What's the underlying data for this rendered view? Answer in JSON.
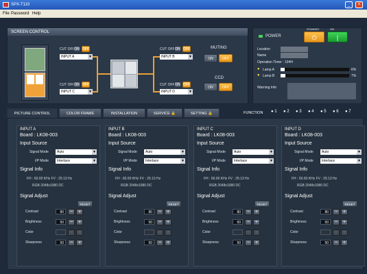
{
  "window": {
    "title": "SPX-T110"
  },
  "menu": [
    "File",
    "Password",
    "Help"
  ],
  "screen_control": {
    "title": "SCREEN CONTROL",
    "cut_off_label": "CUT OFF",
    "on": "ON",
    "off": "OFF",
    "inputs": [
      {
        "value": "INPUT A"
      },
      {
        "value": "INPUT B"
      },
      {
        "value": "INPUT C"
      },
      {
        "value": "INPUT D"
      }
    ],
    "muting_label": "MUTING",
    "ccd_label": "CCD"
  },
  "status": {
    "power_label": "POWER",
    "standby_label": "STANDBY",
    "on_label": "ON",
    "location_label": "Location",
    "name_label": "Name",
    "operation_timer": "Operation Timer : 194H",
    "lamp_a_label": "Lamp A",
    "lamp_a_value": "6%",
    "lamp_b_label": "Lamp B",
    "lamp_b_value": "7%",
    "warning_label": "Warning Info"
  },
  "tabs": [
    {
      "label": "PICTURE CONTROL"
    },
    {
      "label": "COLOR FRAME"
    },
    {
      "label": "INSTALLATION"
    },
    {
      "label": "SERVICE"
    },
    {
      "label": "SETTING"
    }
  ],
  "function": {
    "label": "FUNCTION",
    "items": [
      "1",
      "2",
      "3",
      "4",
      "5",
      "6",
      "7"
    ]
  },
  "input_columns": [
    {
      "name": "INPUT A",
      "board": "Board : LK08-003",
      "input_source": "Input Source",
      "signal_mode_label": "Signal Mode",
      "signal_mode": "Auto",
      "ip_mode_label": "I/P Mode",
      "ip_mode": "Interlace",
      "signal_info": "Signal Info",
      "fh_fv": "FH : 60.00 KHz    FV : 29.13 Hz",
      "rgb": "RGB  2048x1080 DC",
      "signal_adjust": "Signal Adjust",
      "reset": "RESET",
      "contrast_label": "Contrast",
      "contrast": "80",
      "brightness_label": "Brightness",
      "brightness": "50",
      "color_label": "Color",
      "sharpness_label": "Sharpness",
      "sharpness": "50"
    },
    {
      "name": "INPUT B",
      "board": "Board : LK08-003",
      "input_source": "Input Source",
      "signal_mode_label": "Signal Mode",
      "signal_mode": "Auto",
      "ip_mode_label": "I/P Mode",
      "ip_mode": "Interlace",
      "signal_info": "Signal Info",
      "fh_fv": "FH : 60.00 KHz    FV : 29.13 Hz",
      "rgb": "RGB  2048x1080 DC",
      "signal_adjust": "Signal Adjust",
      "reset": "RESET",
      "contrast_label": "Contrast",
      "contrast": "80",
      "brightness_label": "Brightness",
      "brightness": "50",
      "color_label": "Color",
      "sharpness_label": "Sharpness",
      "sharpness": "50"
    },
    {
      "name": "INPUT C",
      "board": "Board : LK08-003",
      "input_source": "Input Source",
      "signal_mode_label": "Signal Mode",
      "signal_mode": "Auto",
      "ip_mode_label": "I/P Mode",
      "ip_mode": "Interlace",
      "signal_info": "Signal Info",
      "fh_fv": "FH : 60.00 KHz    FV : 29.13 Hz",
      "rgb": "RGB  2048x1080 DC",
      "signal_adjust": "Signal Adjust",
      "reset": "RESET",
      "contrast_label": "Contrast",
      "contrast": "80",
      "brightness_label": "Brightness",
      "brightness": "50",
      "color_label": "Color",
      "sharpness_label": "Sharpness",
      "sharpness": "50"
    },
    {
      "name": "INPUT D",
      "board": "Board : LK08-003",
      "input_source": "Input Source",
      "signal_mode_label": "Signal Mode",
      "signal_mode": "Auto",
      "ip_mode_label": "I/P Mode",
      "ip_mode": "Interlace",
      "signal_info": "Signal Info",
      "fh_fv": "FH : 60.00 KHz    FV : 29.13 Hz",
      "rgb": "RGB  2048x1080 DC",
      "signal_adjust": "Signal Adjust",
      "reset": "RESET",
      "contrast_label": "Contrast",
      "contrast": "80",
      "brightness_label": "Brightness",
      "brightness": "50",
      "color_label": "Color",
      "sharpness_label": "Sharpness",
      "sharpness": "50"
    }
  ],
  "colors": {
    "accent_orange": "#e8961a",
    "power_green": "#1fb838",
    "background": "#1e2a3a"
  }
}
